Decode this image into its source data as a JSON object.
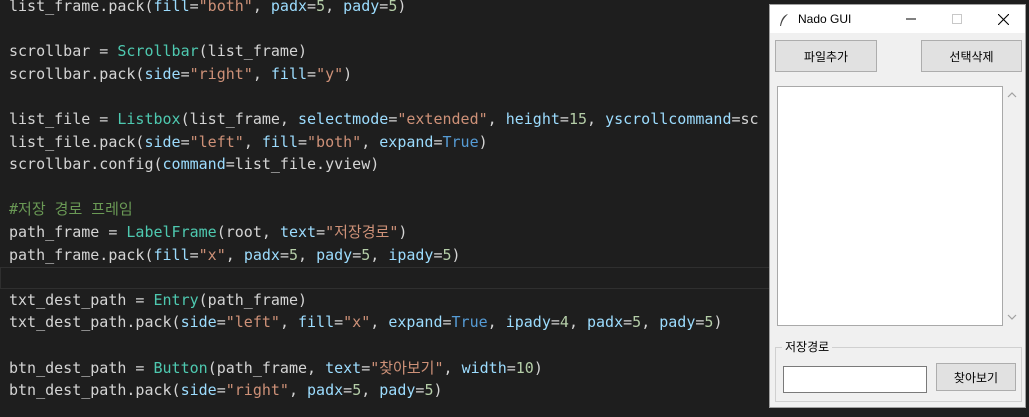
{
  "editor": {
    "lines": [
      [
        [
          "list_frame.pack(",
          "ident"
        ],
        [
          "fill",
          "param"
        ],
        [
          "=",
          "punc"
        ],
        [
          "\"both\"",
          "str"
        ],
        [
          ", ",
          "punc"
        ],
        [
          "padx",
          "param"
        ],
        [
          "=",
          "punc"
        ],
        [
          "5",
          "num"
        ],
        [
          ", ",
          "punc"
        ],
        [
          "pady",
          "param"
        ],
        [
          "=",
          "punc"
        ],
        [
          "5",
          "num"
        ],
        [
          ")",
          "punc"
        ]
      ],
      [],
      [
        [
          "scrollbar = ",
          "ident"
        ],
        [
          "Scrollbar",
          "class"
        ],
        [
          "(list_frame)",
          "ident"
        ]
      ],
      [
        [
          "scrollbar.pack(",
          "ident"
        ],
        [
          "side",
          "param"
        ],
        [
          "=",
          "punc"
        ],
        [
          "\"right\"",
          "str"
        ],
        [
          ", ",
          "punc"
        ],
        [
          "fill",
          "param"
        ],
        [
          "=",
          "punc"
        ],
        [
          "\"y\"",
          "str"
        ],
        [
          ")",
          "punc"
        ]
      ],
      [],
      [
        [
          "list_file = ",
          "ident"
        ],
        [
          "Listbox",
          "class"
        ],
        [
          "(list_frame, ",
          "ident"
        ],
        [
          "selectmode",
          "param"
        ],
        [
          "=",
          "punc"
        ],
        [
          "\"extended\"",
          "str"
        ],
        [
          ", ",
          "punc"
        ],
        [
          "height",
          "param"
        ],
        [
          "=",
          "punc"
        ],
        [
          "15",
          "num"
        ],
        [
          ", ",
          "punc"
        ],
        [
          "yscrollcommand",
          "param"
        ],
        [
          "=sc",
          "punc"
        ]
      ],
      [
        [
          "list_file.pack(",
          "ident"
        ],
        [
          "side",
          "param"
        ],
        [
          "=",
          "punc"
        ],
        [
          "\"left\"",
          "str"
        ],
        [
          ", ",
          "punc"
        ],
        [
          "fill",
          "param"
        ],
        [
          "=",
          "punc"
        ],
        [
          "\"both\"",
          "str"
        ],
        [
          ", ",
          "punc"
        ],
        [
          "expand",
          "param"
        ],
        [
          "=",
          "punc"
        ],
        [
          "True",
          "bool"
        ],
        [
          ")",
          "punc"
        ]
      ],
      [
        [
          "scrollbar.config(",
          "ident"
        ],
        [
          "command",
          "param"
        ],
        [
          "=list_file.yview)",
          "ident"
        ]
      ],
      [],
      [
        [
          "#저장 경로 프레임",
          "comment"
        ]
      ],
      [
        [
          "path_frame = ",
          "ident"
        ],
        [
          "LabelFrame",
          "class"
        ],
        [
          "(root, ",
          "ident"
        ],
        [
          "text",
          "param"
        ],
        [
          "=",
          "punc"
        ],
        [
          "\"저장경로\"",
          "str"
        ],
        [
          ")",
          "punc"
        ]
      ],
      [
        [
          "path_frame.pack(",
          "ident"
        ],
        [
          "fill",
          "param"
        ],
        [
          "=",
          "punc"
        ],
        [
          "\"x\"",
          "str"
        ],
        [
          ", ",
          "punc"
        ],
        [
          "padx",
          "param"
        ],
        [
          "=",
          "punc"
        ],
        [
          "5",
          "num"
        ],
        [
          ", ",
          "punc"
        ],
        [
          "pady",
          "param"
        ],
        [
          "=",
          "punc"
        ],
        [
          "5",
          "num"
        ],
        [
          ", ",
          "punc"
        ],
        [
          "ipady",
          "param"
        ],
        [
          "=",
          "punc"
        ],
        [
          "5",
          "num"
        ],
        [
          ")",
          "punc"
        ]
      ],
      [],
      [
        [
          "txt_dest_path = ",
          "ident"
        ],
        [
          "Entry",
          "class"
        ],
        [
          "(path_frame)",
          "ident"
        ]
      ],
      [
        [
          "txt_dest_path.pack(",
          "ident"
        ],
        [
          "side",
          "param"
        ],
        [
          "=",
          "punc"
        ],
        [
          "\"left\"",
          "str"
        ],
        [
          ", ",
          "punc"
        ],
        [
          "fill",
          "param"
        ],
        [
          "=",
          "punc"
        ],
        [
          "\"x\"",
          "str"
        ],
        [
          ", ",
          "punc"
        ],
        [
          "expand",
          "param"
        ],
        [
          "=",
          "punc"
        ],
        [
          "True",
          "bool"
        ],
        [
          ", ",
          "punc"
        ],
        [
          "ipady",
          "param"
        ],
        [
          "=",
          "punc"
        ],
        [
          "4",
          "num"
        ],
        [
          ", ",
          "punc"
        ],
        [
          "padx",
          "param"
        ],
        [
          "=",
          "punc"
        ],
        [
          "5",
          "num"
        ],
        [
          ", ",
          "punc"
        ],
        [
          "pady",
          "param"
        ],
        [
          "=",
          "punc"
        ],
        [
          "5",
          "num"
        ],
        [
          ")",
          "punc"
        ]
      ],
      [],
      [
        [
          "btn_dest_path = ",
          "ident"
        ],
        [
          "Button",
          "class"
        ],
        [
          "(path_frame, ",
          "ident"
        ],
        [
          "text",
          "param"
        ],
        [
          "=",
          "punc"
        ],
        [
          "\"찾아보기\"",
          "str"
        ],
        [
          ", ",
          "punc"
        ],
        [
          "width",
          "param"
        ],
        [
          "=",
          "punc"
        ],
        [
          "10",
          "num"
        ],
        [
          ")",
          "punc"
        ]
      ],
      [
        [
          "btn_dest_path.pack(",
          "ident"
        ],
        [
          "side",
          "param"
        ],
        [
          "=",
          "punc"
        ],
        [
          "\"right\"",
          "str"
        ],
        [
          ", ",
          "punc"
        ],
        [
          "padx",
          "param"
        ],
        [
          "=",
          "punc"
        ],
        [
          "5",
          "num"
        ],
        [
          ", ",
          "punc"
        ],
        [
          "pady",
          "param"
        ],
        [
          "=",
          "punc"
        ],
        [
          "5",
          "num"
        ],
        [
          ")",
          "punc"
        ]
      ]
    ]
  },
  "window": {
    "title": "Nado GUI",
    "icon": "feather-icon",
    "controls": [
      "minimize-icon",
      "maximize-icon",
      "close-icon"
    ]
  },
  "buttons": {
    "add_files": "파일추가",
    "delete_selected": "선택삭제",
    "browse": "찾아보기"
  },
  "path_frame": {
    "label": "저장경로",
    "entry_value": ""
  },
  "colors": {
    "editor_bg": "#1e1e1e",
    "window_bg": "#f0f0f0",
    "keyword_class": "#4ec9b0",
    "string": "#ce9178",
    "number": "#b5cea8",
    "param": "#9cdcfe",
    "comment": "#6a9955"
  }
}
